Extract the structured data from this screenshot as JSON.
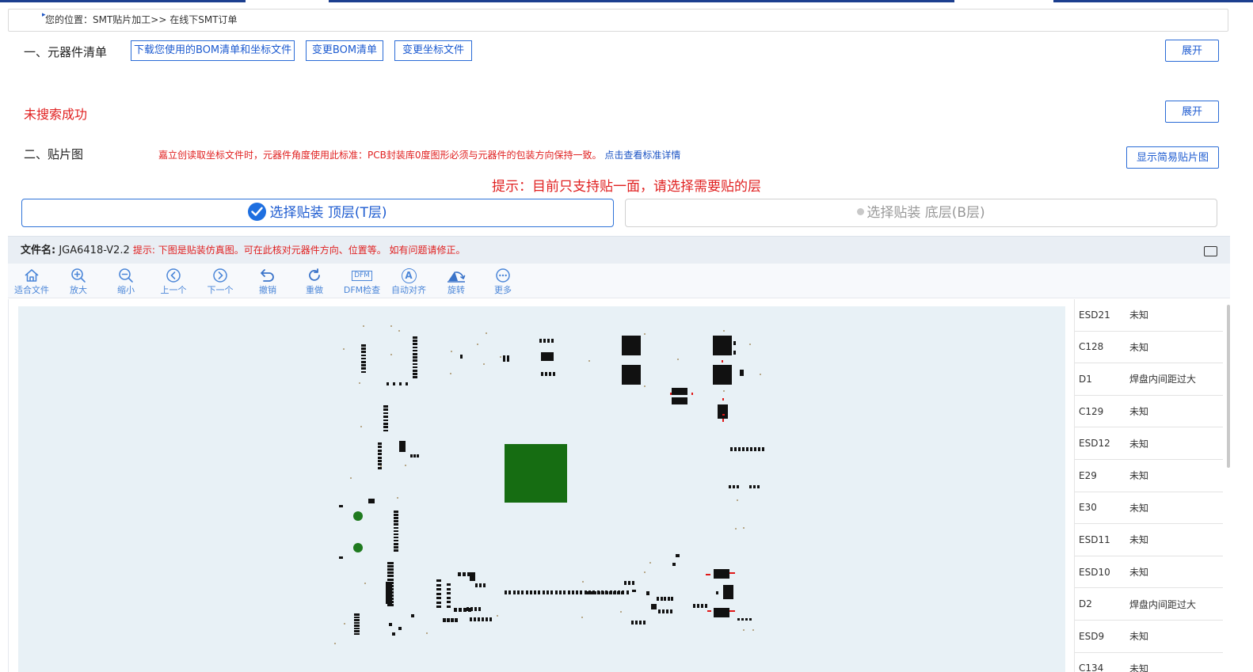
{
  "breadcrumb": {
    "text": "您的位置：SMT贴片加工>> 在线下SMT订单"
  },
  "bom": {
    "title": "一、元器件清单",
    "download_button": "下载您使用的BOM清单和坐标文件",
    "change_bom_button": "变更BOM清单",
    "change_coord_button": "变更坐标文件",
    "expand_button": "展开"
  },
  "search": {
    "status": "未搜索成功",
    "expand_button": "展开"
  },
  "placement": {
    "title": "二、贴片图",
    "notice": "嘉立创读取坐标文件时，元器件角度使用此标准：PCB封装库0度图形必须与元器件的包装方向保持一致。",
    "notice_link": "点击查看标准详情",
    "simple_view_button": "显示简易贴片图",
    "hint": "提示：目前只支持贴一面，请选择需要贴的层",
    "top_layer_tab": "选择贴装 顶层(T层)",
    "bottom_layer_tab": "选择贴装 底层(B层)"
  },
  "file_bar": {
    "label": "文件名:",
    "filename": "JGA6418-V2.2",
    "tip": "提示: 下图是贴装仿真图。可在此核对元器件方向、位置等。 如有问题请修正。"
  },
  "toolbar": [
    {
      "label": "适合文件",
      "icon": "home-icon"
    },
    {
      "label": "放大",
      "icon": "zoom-in-icon"
    },
    {
      "label": "缩小",
      "icon": "zoom-out-icon"
    },
    {
      "label": "上一个",
      "icon": "prev-icon"
    },
    {
      "label": "下一个",
      "icon": "next-icon"
    },
    {
      "label": "撤销",
      "icon": "undo-icon"
    },
    {
      "label": "重做",
      "icon": "redo-icon"
    },
    {
      "label": "DFM检查",
      "icon": "dfm-icon",
      "badge": "DFM"
    },
    {
      "label": "自动对齐",
      "icon": "auto-align-icon",
      "badge": "A"
    },
    {
      "label": "旋转",
      "icon": "rotate-icon"
    },
    {
      "label": "更多",
      "icon": "more-icon"
    }
  ],
  "components": [
    {
      "ref": "ESD21",
      "status": "未知"
    },
    {
      "ref": "C128",
      "status": "未知"
    },
    {
      "ref": "D1",
      "status": "焊盘内间距过大"
    },
    {
      "ref": "C129",
      "status": "未知"
    },
    {
      "ref": "ESD12",
      "status": "未知"
    },
    {
      "ref": "E29",
      "status": "未知"
    },
    {
      "ref": "E30",
      "status": "未知"
    },
    {
      "ref": "ESD11",
      "status": "未知"
    },
    {
      "ref": "ESD10",
      "status": "未知"
    },
    {
      "ref": "D2",
      "status": "焊盘内间距过大"
    },
    {
      "ref": "ESD9",
      "status": "未知"
    },
    {
      "ref": "C134",
      "status": "未知"
    }
  ],
  "colors": {
    "accent": "#1d5bd0",
    "error": "#e02020",
    "board": "#e8f1f6",
    "chip": "#166d12",
    "fiducial": "#1f7a1f"
  }
}
